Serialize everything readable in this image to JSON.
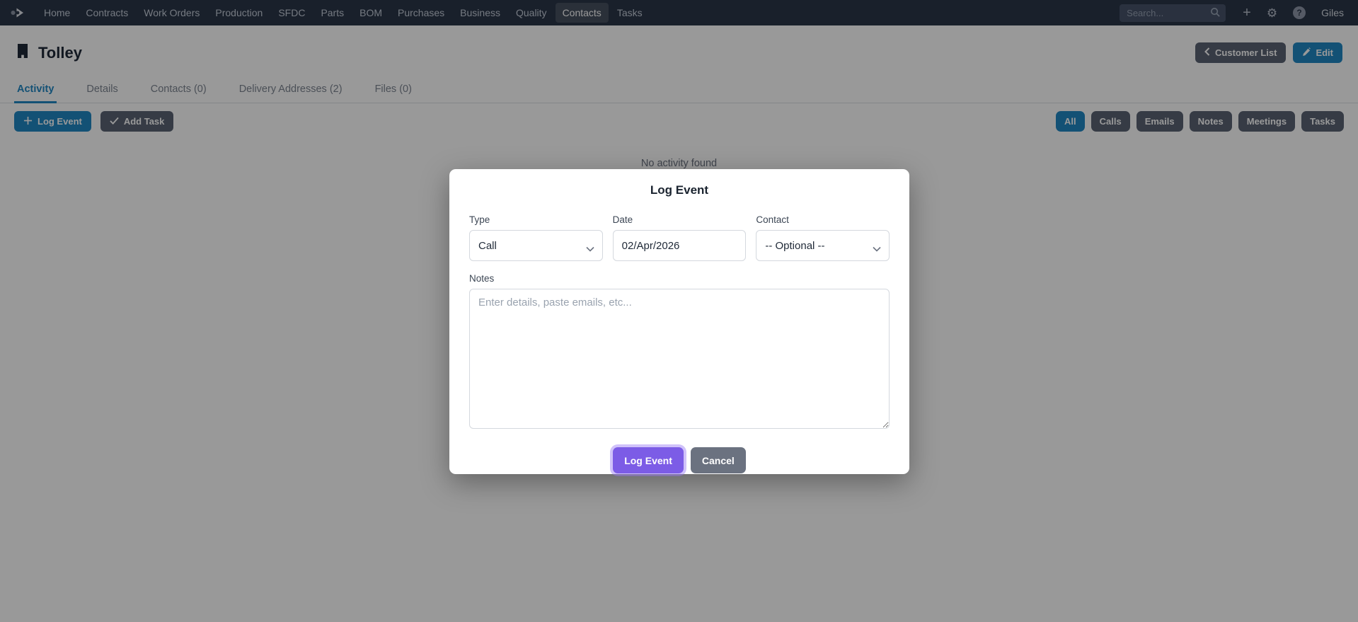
{
  "navbar": {
    "items": [
      {
        "label": "Home"
      },
      {
        "label": "Contracts"
      },
      {
        "label": "Work Orders"
      },
      {
        "label": "Production"
      },
      {
        "label": "SFDC"
      },
      {
        "label": "Parts"
      },
      {
        "label": "BOM"
      },
      {
        "label": "Purchases"
      },
      {
        "label": "Business"
      },
      {
        "label": "Quality"
      },
      {
        "label": "Contacts",
        "active": true
      },
      {
        "label": "Tasks"
      }
    ],
    "search_placeholder": "Search...",
    "help_glyph": "?",
    "user": "Giles"
  },
  "header": {
    "title": "Tolley",
    "customer_list_button": "Customer List",
    "edit_button": "Edit"
  },
  "tabs": [
    {
      "label": "Activity",
      "active": true
    },
    {
      "label": "Details"
    },
    {
      "label": "Contacts (0)"
    },
    {
      "label": "Delivery Addresses (2)"
    },
    {
      "label": "Files (0)"
    }
  ],
  "actions": {
    "log_event": "Log Event",
    "add_task": "Add Task"
  },
  "filters": [
    {
      "label": "All",
      "active": true
    },
    {
      "label": "Calls"
    },
    {
      "label": "Emails"
    },
    {
      "label": "Notes"
    },
    {
      "label": "Meetings"
    },
    {
      "label": "Tasks"
    }
  ],
  "content": {
    "empty_message": "No activity found"
  },
  "modal": {
    "title": "Log Event",
    "type_label": "Type",
    "type_value": "Call",
    "date_label": "Date",
    "date_value": "02/Apr/2026",
    "contact_label": "Contact",
    "contact_value": "-- Optional --",
    "notes_label": "Notes",
    "notes_placeholder": "Enter details, paste emails, etc...",
    "submit_button": "Log Event",
    "cancel_button": "Cancel"
  },
  "icons": {
    "logo": "app-logo",
    "search": "magnifier",
    "create": "plus",
    "settings": "gear",
    "help": "question-circle",
    "customer": "building",
    "back": "chevron-left",
    "edit": "pencil",
    "log_event": "plus",
    "add_task": "check",
    "dropdown": "chevron-down"
  },
  "colors": {
    "navbar_bg": "#2b3649",
    "primary_blue": "#2187c4",
    "accent_purple": "#7c5ce6",
    "button_gray": "#5a6374",
    "overlay": "rgba(0,0,0,0.40)"
  }
}
